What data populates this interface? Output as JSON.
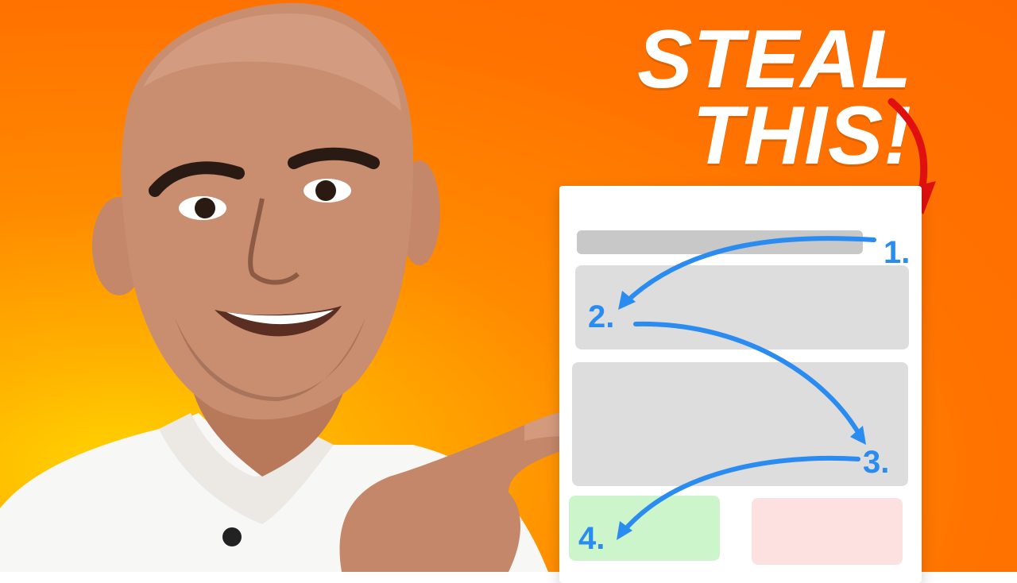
{
  "headline": {
    "line1": "STEAL",
    "line2": "THIS!"
  },
  "steps": [
    "1.",
    "2.",
    "3.",
    "4."
  ],
  "colors": {
    "background": "#ff7200",
    "highlight": "#ffd400",
    "headline_text": "#ffffff",
    "step_arrows": "#2a8cf0",
    "red_arrow": "#e01010",
    "block_gray": "#dddddd",
    "block_green": "#ccf5cc",
    "block_pink": "#fde1e1"
  },
  "icons": [
    "red-curved-arrow-icon",
    "blue-flow-arrow-icon"
  ]
}
